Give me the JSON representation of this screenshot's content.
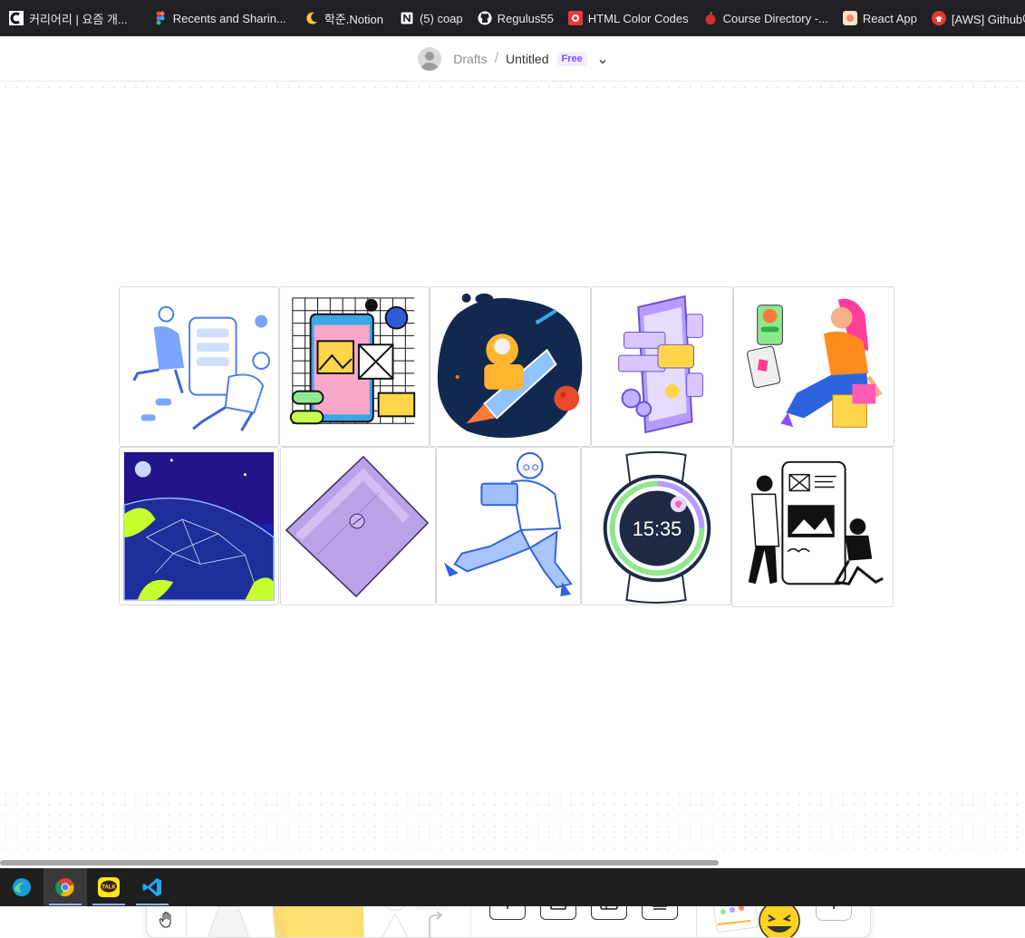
{
  "bookmarks": [
    {
      "label": "커리어리 | 요즘 개...",
      "icon": "careerly-icon",
      "color": "#ffffff"
    },
    {
      "label": "Recents and Sharin...",
      "icon": "figma-icon",
      "color": "#f24e1e"
    },
    {
      "label": "학준.Notion",
      "icon": "moon-icon",
      "color": "#f5c542"
    },
    {
      "label": "(5) coap",
      "icon": "notion-icon",
      "color": "#ffffff"
    },
    {
      "label": "Regulus55",
      "icon": "github-icon",
      "color": "#ffffff"
    },
    {
      "label": "HTML Color Codes",
      "icon": "color-codes-icon",
      "color": "#e53935"
    },
    {
      "label": "Course Directory -...",
      "icon": "apple-icon",
      "color": "#d32f2f"
    },
    {
      "label": "React App",
      "icon": "react-app-icon",
      "color": "#ff8a65"
    },
    {
      "label": "[AWS] Github에 A...",
      "icon": "aws-icon",
      "color": "#e53935"
    }
  ],
  "header": {
    "breadcrumb_parent": "Drafts",
    "separator": "/",
    "file_title": "Untitled",
    "plan_badge": "Free"
  },
  "watch_time": "15:35",
  "colors": {
    "accent": "#9747ff",
    "badge_bg": "#f1ecff",
    "badge_text": "#7b4fff"
  },
  "gallery": {
    "row1": [
      "people-phone-illustration",
      "mobile-design-illustration",
      "astronaut-rocket-illustration",
      "isometric-phone-illustration",
      "woman-shopping-illustration"
    ],
    "row2": [
      "planet-network-illustration",
      "purple-paper-illustration",
      "man-laptop-illustration",
      "smartwatch-illustration",
      "people-ui-illustration"
    ]
  },
  "toolbar": {
    "tools": [
      "select-tool",
      "hand-tool",
      "marker-tool",
      "sticky-note-tool",
      "shapes-tool",
      "text-tool",
      "section-tool",
      "table-tool",
      "stamp-tool",
      "widgets-tool",
      "more-tools"
    ]
  },
  "taskbar": [
    "edge-app",
    "chrome-app",
    "kakaotalk-app",
    "vscode-app"
  ]
}
